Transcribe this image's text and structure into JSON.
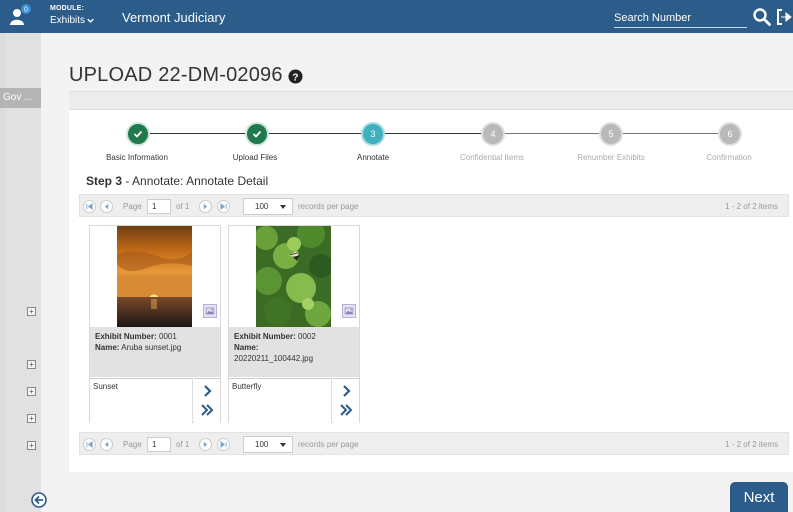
{
  "header": {
    "module_label": "MODULE:",
    "module_value": "Exhibits",
    "app_title": "Vermont Judiciary",
    "notification_count": "0",
    "search_placeholder": "Search Number"
  },
  "sidebar": {
    "tab_label": "Gov ..."
  },
  "page": {
    "title": "UPLOAD 22-DM-02096"
  },
  "stepper": {
    "steps": [
      {
        "number": "1",
        "label": "Basic Information",
        "state": "done"
      },
      {
        "number": "2",
        "label": "Upload Files",
        "state": "done"
      },
      {
        "number": "3",
        "label": "Annotate",
        "state": "active"
      },
      {
        "number": "4",
        "label": "Confidential Items",
        "state": "todo"
      },
      {
        "number": "5",
        "label": "Renumber Exhibits",
        "state": "todo"
      },
      {
        "number": "6",
        "label": "Confirmation",
        "state": "todo"
      }
    ]
  },
  "step_heading": {
    "prefix": "Step 3",
    "text": " - Annotate: Annotate Detail"
  },
  "pager": {
    "page_label": "Page",
    "page_value": "1",
    "of_label": "of 1",
    "page_size": "100",
    "per_page_label": "records per page",
    "items_label": "1 - 2 of 2 items"
  },
  "exhibits": [
    {
      "number_label": "Exhibit Number:",
      "number": "0001",
      "name_label": "Name:",
      "name": "Aruba sunset.jpg",
      "note": "Sunset"
    },
    {
      "number_label": "Exhibit Number:",
      "number": "0002",
      "name_label": "Name:",
      "name": "20220211_100442.jpg",
      "note": "Butterfly"
    }
  ],
  "footer": {
    "next_label": "Next"
  },
  "colors": {
    "primary": "#2b5c8a",
    "step_done": "#217a4d",
    "step_active": "#3fb0bd",
    "step_todo": "#b9b9b9"
  }
}
